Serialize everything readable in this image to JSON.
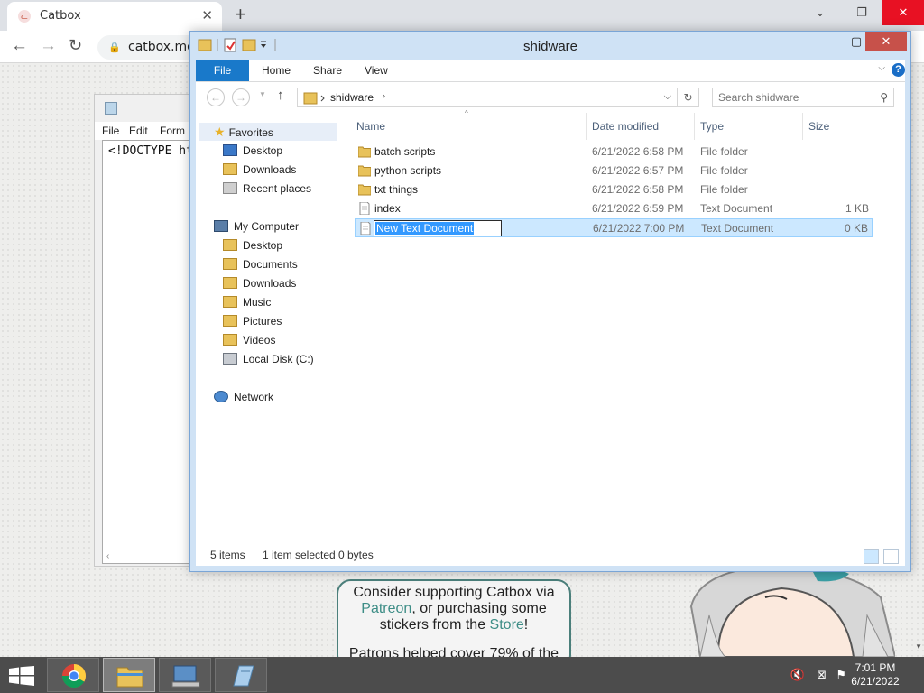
{
  "browser": {
    "tab_title": "Catbox",
    "tab_close": "✕",
    "new_tab": "+",
    "url": "catbox.moe",
    "window_controls": {
      "minimize": "⌄",
      "restore": "❐",
      "close": "✕"
    }
  },
  "notepad": {
    "menu": [
      "File",
      "Edit",
      "Form"
    ],
    "text": "<!DOCTYPE ht"
  },
  "website": {
    "promo_line1": "Consider supporting Catbox via",
    "promo_patreon": "Patreon",
    "promo_line2a": ", or purchasing some",
    "promo_line3a": "stickers from the ",
    "promo_store": "Store",
    "promo_line3b": "!",
    "promo_line4": "Patrons helped cover 79% of the",
    "accent_color": "#3d8d86"
  },
  "explorer": {
    "title": "shidware",
    "ribbon_tabs": [
      "File",
      "Home",
      "Share",
      "View"
    ],
    "help_label": "?",
    "breadcrumb": "shidware",
    "search_placeholder": "Search shidware",
    "nav": {
      "favorites": "Favorites",
      "favorites_items": [
        "Desktop",
        "Downloads",
        "Recent places"
      ],
      "computer": "My Computer",
      "computer_items": [
        "Desktop",
        "Documents",
        "Downloads",
        "Music",
        "Pictures",
        "Videos",
        "Local Disk (C:)"
      ],
      "network": "Network"
    },
    "columns": {
      "name": "Name",
      "date": "Date modified",
      "type": "Type",
      "size": "Size"
    },
    "files": [
      {
        "name": "batch scripts",
        "date": "6/21/2022 6:58 PM",
        "type": "File folder",
        "size": "",
        "icon": "folder-icon"
      },
      {
        "name": "python scripts",
        "date": "6/21/2022 6:57 PM",
        "type": "File folder",
        "size": "",
        "icon": "folder-icon"
      },
      {
        "name": "txt things",
        "date": "6/21/2022 6:58 PM",
        "type": "File folder",
        "size": "",
        "icon": "folder-icon"
      },
      {
        "name": "index",
        "date": "6/21/2022 6:59 PM",
        "type": "Text Document",
        "size": "1 KB",
        "icon": "text-file-icon"
      },
      {
        "name": "New Text Document",
        "date": "6/21/2022 7:00 PM",
        "type": "Text Document",
        "size": "0 KB",
        "icon": "text-file-icon"
      }
    ],
    "status": {
      "items": "5 items",
      "selected": "1 item selected",
      "bytes": "0 bytes"
    },
    "selection_color": "#cce8ff",
    "ribbon_file_color": "#1979ca"
  },
  "taskbar": {
    "time": "7:01 PM",
    "date": "6/21/2022"
  }
}
